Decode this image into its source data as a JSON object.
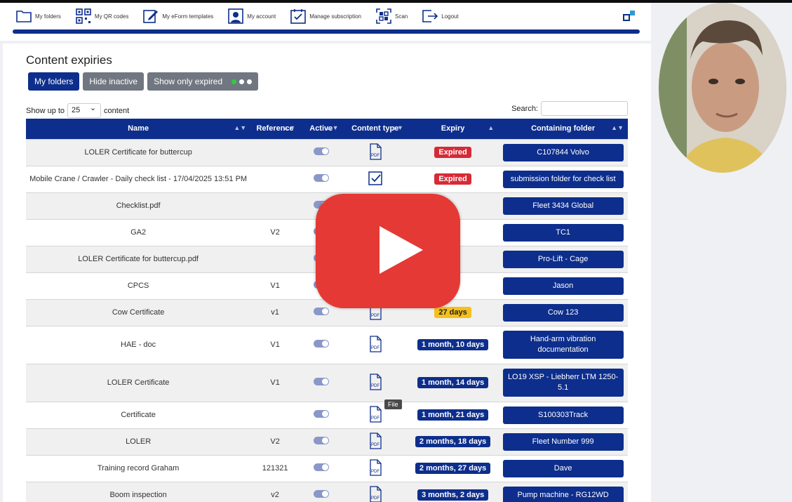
{
  "nav": {
    "items": [
      {
        "label": "My folders",
        "icon": "folder-icon"
      },
      {
        "label": "My QR codes",
        "icon": "qr-code-icon"
      },
      {
        "label": "My eForm templates",
        "icon": "edit-icon"
      },
      {
        "label": "My account",
        "icon": "user-icon"
      },
      {
        "label": "Manage subscription",
        "icon": "calendar-check-icon"
      },
      {
        "label": "Scan",
        "icon": "scan-icon"
      },
      {
        "label": "Logout",
        "icon": "logout-icon"
      }
    ]
  },
  "page": {
    "title": "Content expiries",
    "buttons": {
      "my_folders": "My folders",
      "hide_inactive": "Hide inactive",
      "show_expired": "Show only expired"
    },
    "show_up_to": "Show up to",
    "page_size": "25",
    "content_suffix": "content",
    "search_label": "Search:"
  },
  "table": {
    "columns": [
      "Name",
      "Reference",
      "Active",
      "Content type",
      "Expiry",
      "Containing folder"
    ],
    "rows": [
      {
        "name": "LOLER Certificate for buttercup",
        "ref": "",
        "active": true,
        "type": "pdf",
        "expiry": "Expired",
        "status": "red",
        "folder": "C107844 Volvo"
      },
      {
        "name": "Mobile Crane / Crawler - Daily check list - 17/04/2025 13:51 PM",
        "ref": "",
        "active": true,
        "type": "checklist",
        "expiry": "Expired",
        "status": "red",
        "folder": "submission folder for check list"
      },
      {
        "name": "Checklist.pdf",
        "ref": "",
        "active": true,
        "type": "pdf",
        "expiry": "",
        "status": "yellow",
        "folder": "Fleet 3434 Global"
      },
      {
        "name": "GA2",
        "ref": "V2",
        "active": true,
        "type": "pdf",
        "expiry": "",
        "status": "yellow",
        "folder": "TC1"
      },
      {
        "name": "LOLER Certificate for buttercup.pdf",
        "ref": "",
        "active": true,
        "type": "pdf",
        "expiry": "",
        "status": "yellow",
        "folder": "Pro-Lift - Cage"
      },
      {
        "name": "CPCS",
        "ref": "V1",
        "active": true,
        "type": "pdf",
        "expiry": "",
        "status": "yellow",
        "folder": "Jason"
      },
      {
        "name": "Cow Certificate",
        "ref": "v1",
        "active": true,
        "type": "pdf",
        "expiry": "27 days",
        "status": "yellow",
        "folder": "Cow 123"
      },
      {
        "name": "HAE - doc",
        "ref": "V1",
        "active": true,
        "type": "pdf",
        "expiry": "1 month, 10 days",
        "status": "blue",
        "folder": "Hand-arm vibration documentation"
      },
      {
        "name": "LOLER Certificate",
        "ref": "V1",
        "active": true,
        "type": "pdf",
        "expiry": "1 month, 14 days",
        "status": "blue",
        "folder": "LO19 XSP - Liebherr LTM 1250-5.1"
      },
      {
        "name": "Certificate",
        "ref": "",
        "active": true,
        "type": "pdf",
        "expiry": "1 month, 21 days",
        "status": "blue",
        "folder": "S100303Track"
      },
      {
        "name": "LOLER",
        "ref": "V2",
        "active": true,
        "type": "pdf",
        "expiry": "2 months, 18 days",
        "status": "blue",
        "folder": "Fleet Number 999"
      },
      {
        "name": "Training record Graham",
        "ref": "121321",
        "active": true,
        "type": "pdf",
        "expiry": "2 months, 27 days",
        "status": "blue",
        "folder": "Dave"
      },
      {
        "name": "Boom inspection",
        "ref": "v2",
        "active": true,
        "type": "pdf",
        "expiry": "3 months, 2 days",
        "status": "blue",
        "folder": "Pump machine - RG12WD"
      }
    ]
  },
  "tooltip": "File",
  "pdf_label": "PDF",
  "colors": {
    "brand": "#0d2e8c",
    "expired": "#d62a36",
    "warning": "#f5c01b",
    "video_play": "#e53935"
  }
}
